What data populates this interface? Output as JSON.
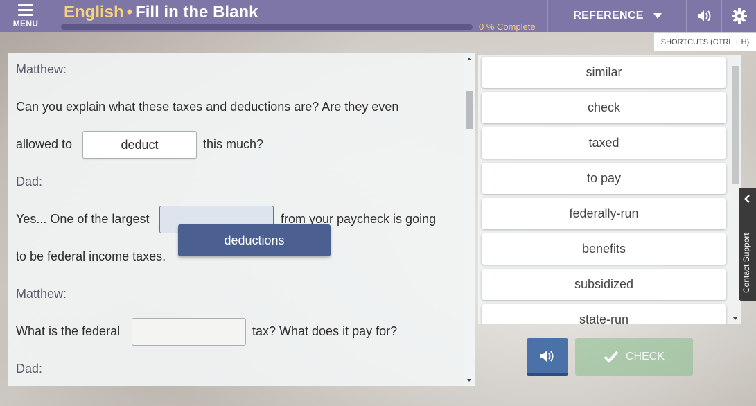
{
  "header": {
    "menu_label": "MENU",
    "subject": "English",
    "separator": "•",
    "activity": "Fill in the Blank",
    "progress_text": "0 % Complete",
    "progress_fraction": 0,
    "reference_label": "REFERENCE",
    "shortcuts_label": "SHORTCUTS (CTRL + H)"
  },
  "passage": {
    "speaker_1": "Matthew:",
    "line_1": "Can you explain what these taxes and deductions are? Are they even",
    "line_2_before": "allowed to",
    "blank_1_value": "deduct",
    "line_2_after": "this much?",
    "speaker_2": "Dad:",
    "line_3_before": "Yes... One of the largest",
    "blank_2_value": "",
    "line_3_after": "from your paycheck is going",
    "line_4": "to be federal income taxes.",
    "dragging_word": "deductions",
    "speaker_3": "Matthew:",
    "line_5_before": "What is the federal",
    "blank_3_value": "",
    "line_5_after": "tax? What does it pay for?",
    "speaker_4": "Dad:"
  },
  "word_bank": [
    "similar",
    "check",
    "taxed",
    "to pay",
    "federally-run",
    "benefits",
    "subsidized",
    "state-run"
  ],
  "support_label": "Contact Support",
  "buttons": {
    "check_label": "CHECK"
  },
  "icons": {
    "menu": "hamburger-icon",
    "reference_caret": "caret-down-icon",
    "audio": "speaker-icon",
    "settings": "gear-icon",
    "support_chevron": "chevron-left-icon",
    "check": "checkmark-icon"
  },
  "colors": {
    "topbar": "#7d76a6",
    "accent_gold": "#f6d27a",
    "drag_chip": "#4b6090",
    "audio_button": "#4a72a8",
    "check_button": "#87be8c"
  }
}
